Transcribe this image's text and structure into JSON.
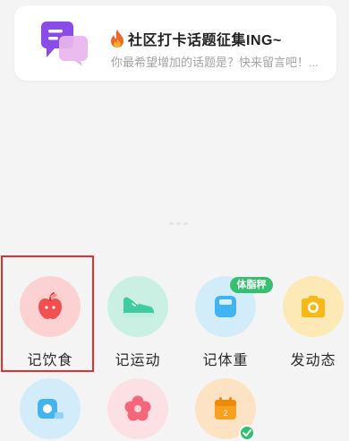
{
  "topic_card": {
    "title": "社区打卡话题征集ING~",
    "subtitle": "你最希望增加的话题是？快来留言吧！..."
  },
  "quick_actions": [
    {
      "label": "记饮食",
      "icon": "apple-icon",
      "color": "#fbd2d1"
    },
    {
      "label": "记运动",
      "icon": "sneaker-icon",
      "color": "#c9f0e3"
    },
    {
      "label": "记体重",
      "icon": "scale-icon",
      "color": "#d2ecf9"
    },
    {
      "label": "发动态",
      "icon": "camera-icon",
      "color": "#fde9b5"
    }
  ],
  "weight_badge": "体脂秤",
  "second_row": [
    {
      "icon": "tape-measure-icon",
      "color": "#d2ecf9"
    },
    {
      "icon": "flower-icon",
      "color": "#fde0e3"
    },
    {
      "icon": "calendar-icon",
      "color": "#fde3c3",
      "calendar_day": "2"
    }
  ],
  "accent_colors": {
    "highlight": "#e3302f",
    "green": "#34c06e"
  }
}
